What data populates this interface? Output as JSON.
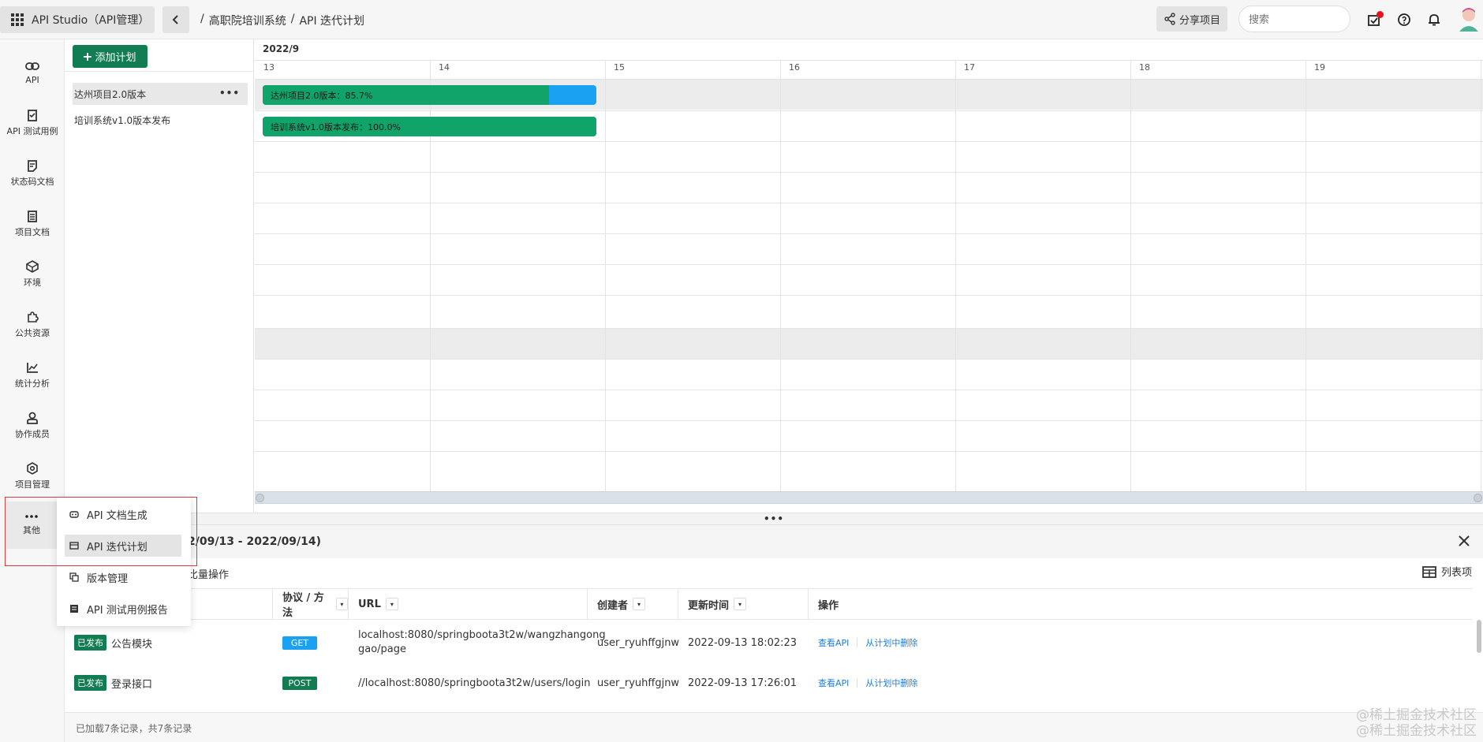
{
  "app": {
    "title": "API Studio（API管理）"
  },
  "breadcrumb": {
    "sep1": "/",
    "project": "高职院培训系统",
    "sep2": "/",
    "page": "API 迭代计划"
  },
  "header": {
    "share_label": "分享项目",
    "search_placeholder": "搜索",
    "notify_dot_color": "#e8141a"
  },
  "sidebar": {
    "items": [
      {
        "label": "API",
        "icon": "link-icon"
      },
      {
        "label": "API 测试用例",
        "icon": "clipboard-icon"
      },
      {
        "label": "状态码文档",
        "icon": "doc-icon"
      },
      {
        "label": "项目文档",
        "icon": "list-doc-icon"
      },
      {
        "label": "环境",
        "icon": "cube-icon"
      },
      {
        "label": "公共资源",
        "icon": "puzzle-icon"
      },
      {
        "label": "统计分析",
        "icon": "chart-icon"
      },
      {
        "label": "协作成员",
        "icon": "user-icon"
      },
      {
        "label": "项目管理",
        "icon": "gear-icon"
      },
      {
        "label": "其他",
        "icon": "more-icon"
      }
    ]
  },
  "plans": {
    "add_label": "添加计划",
    "items": [
      {
        "name": "达州项目2.0版本"
      },
      {
        "name": "培训系统v1.0版本发布"
      }
    ]
  },
  "gantt": {
    "month": "2022/9",
    "days": [
      "13",
      "14",
      "15",
      "16",
      "17",
      "18",
      "19"
    ],
    "bars": [
      {
        "label": "达州项目2.0版本：85.7%",
        "progress": 85.7
      },
      {
        "label": "培训系统v1.0版本发布：100.0%",
        "progress": 100.0
      }
    ],
    "colors": {
      "done": "#10a36a",
      "remaining": "#1ba1f2"
    }
  },
  "popup": {
    "items": [
      {
        "label": "API 文档生成"
      },
      {
        "label": "API 迭代计划"
      },
      {
        "label": "版本管理"
      },
      {
        "label": "API 测试用例报告"
      }
    ]
  },
  "detail": {
    "title": "2/09/13 - 2022/09/14)",
    "batch_label": "比量操作",
    "columns_label": "列表项",
    "headers": {
      "method": "协议 / 方法",
      "url": "URL",
      "creator": "创建者",
      "updated": "更新时间",
      "actions": "操作"
    },
    "rows": [
      {
        "status": "已发布",
        "name": "公告模块",
        "method": "GET",
        "url1": "localhost:8080/springboota3t2w/wangzhangong",
        "url2": "gao/page",
        "creator": "user_ryuhffgjnw",
        "updated": "2022-09-13 18:02:23",
        "view": "查看API",
        "remove": "从计划中删除"
      },
      {
        "status": "已发布",
        "name": "登录接口",
        "method": "POST",
        "url1": "//localhost:8080/springboota3t2w/users/login",
        "url2": "",
        "creator": "user_ryuhffgjnw",
        "updated": "2022-09-13 17:26:01",
        "view": "查看API",
        "remove": "从计划中删除"
      }
    ],
    "footer": "已加载7条记录，共7条记录"
  },
  "watermark": {
    "line1": "@稀土掘金技术社区",
    "line2": "@稀土掘金技术社区"
  }
}
